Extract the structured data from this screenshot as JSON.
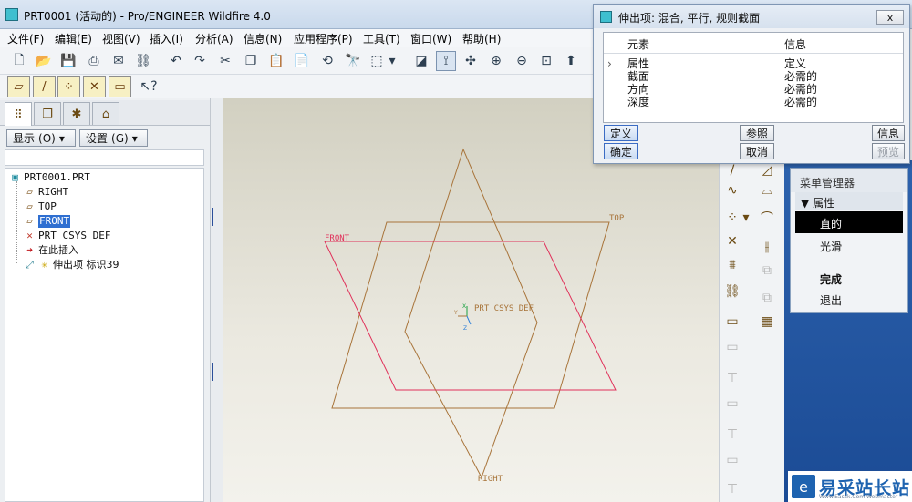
{
  "window": {
    "title": "PRT0001 (活动的) - Pro/ENGINEER Wildfire 4.0"
  },
  "menubar": {
    "items": [
      "文件(F)",
      "编辑(E)",
      "视图(V)",
      "插入(I)",
      "分析(A)",
      "信息(N)",
      "应用程序(P)",
      "工具(T)",
      "窗口(W)",
      "帮助(H)"
    ]
  },
  "navigator": {
    "show_label": "显示",
    "show_key": "(O)",
    "settings_label": "设置",
    "settings_key": "(G)",
    "tree": {
      "root": "PRT0001.PRT",
      "items": [
        "RIGHT",
        "TOP",
        "FRONT",
        "PRT_CSYS_DEF",
        "在此插入",
        "伸出项  标识39"
      ],
      "selected": "FRONT"
    }
  },
  "graphics": {
    "labels": {
      "top": "TOP",
      "front": "FRONT",
      "right": "RIGHT",
      "csys": "PRT_CSYS_DEF",
      "axis_x": "X",
      "axis_y": "Y",
      "axis_z": "Z"
    },
    "colors": {
      "datum_plane": "#a8743a",
      "sketch_plane": "#e0315a",
      "background_top": "#d2d0c1",
      "background_bottom": "#f3f2ec"
    }
  },
  "dialog": {
    "title": "伸出项: 混合, 平行, 规则截面",
    "close_label": "ⅹ",
    "columns": [
      "元素",
      "信息"
    ],
    "rows": [
      {
        "element": "属性",
        "info": "定义"
      },
      {
        "element": "截面",
        "info": "必需的"
      },
      {
        "element": "方向",
        "info": "必需的"
      },
      {
        "element": "深度",
        "info": "必需的"
      }
    ],
    "buttons": {
      "define": "定义",
      "reference": "参照",
      "info": "信息",
      "ok": "确定",
      "cancel": "取消",
      "preview": "预览"
    }
  },
  "menu_manager": {
    "title": "菜单管理器",
    "section": "属性",
    "items": [
      "直的",
      "光滑",
      "完成",
      "退出"
    ],
    "selected": "直的"
  },
  "watermark": {
    "text": "易采站长站",
    "sub": "Www.Easck.Com  Webmaster"
  }
}
